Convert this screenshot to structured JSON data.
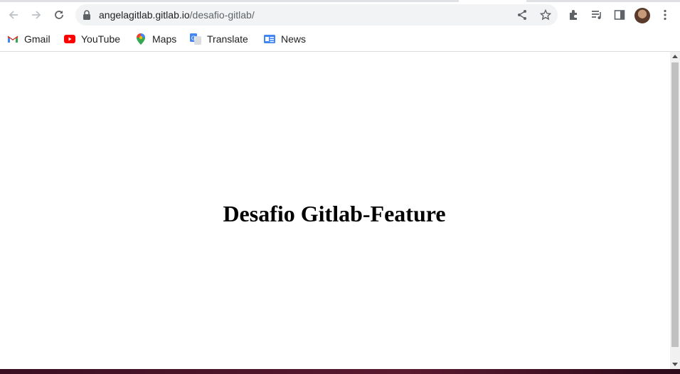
{
  "browser": {
    "url_host": "angelagitlab.gitlab.io",
    "url_path": "/desafio-gitlab/"
  },
  "bookmarks": [
    {
      "label": "Gmail",
      "icon": "gmail-icon"
    },
    {
      "label": "YouTube",
      "icon": "youtube-icon"
    },
    {
      "label": "Maps",
      "icon": "maps-icon"
    },
    {
      "label": "Translate",
      "icon": "translate-icon"
    },
    {
      "label": "News",
      "icon": "news-icon"
    }
  ],
  "page": {
    "heading": "Desafio Gitlab-Feature"
  },
  "colors": {
    "omnibox": "#f1f3f4",
    "icon": "#5f6368",
    "scroll_thumb": "#c1c1c1"
  }
}
